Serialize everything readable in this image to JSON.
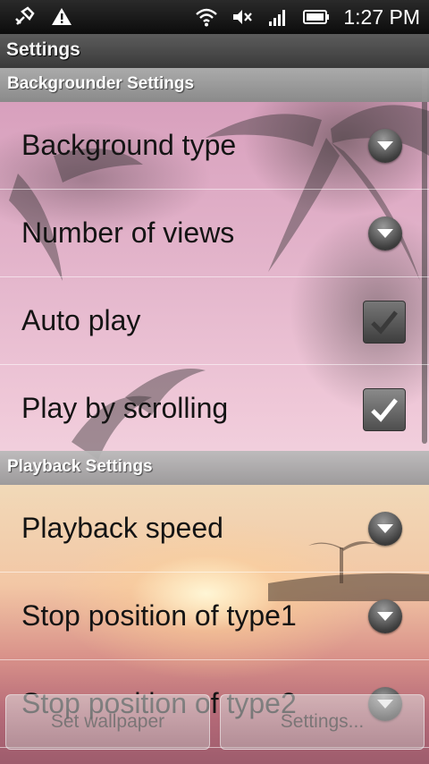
{
  "status_bar": {
    "time": "1:27 PM",
    "icons": [
      "usb-debug-icon",
      "warning-icon",
      "wifi-icon",
      "mute-icon",
      "signal-icon",
      "battery-icon"
    ]
  },
  "title_bar": {
    "title": "Settings"
  },
  "sections": [
    {
      "header": "Backgrounder Settings",
      "items": [
        {
          "label": "Background type",
          "control": "dropdown"
        },
        {
          "label": "Number of views",
          "control": "dropdown"
        },
        {
          "label": "Auto play",
          "control": "checkbox",
          "checked": true
        },
        {
          "label": "Play by scrolling",
          "control": "checkbox",
          "checked": true
        }
      ]
    },
    {
      "header": "Playback Settings",
      "items": [
        {
          "label": "Playback speed",
          "control": "dropdown"
        },
        {
          "label": "Stop position of type1",
          "control": "dropdown"
        },
        {
          "label": "Stop position of type2",
          "control": "dropdown"
        }
      ]
    }
  ],
  "buttons": {
    "set_wallpaper": "Set wallpaper",
    "settings": "Settings..."
  },
  "colors": {
    "status_bar": "#111111",
    "title_bar": "#4a4a4a",
    "section_header": "#a8a8a8"
  }
}
